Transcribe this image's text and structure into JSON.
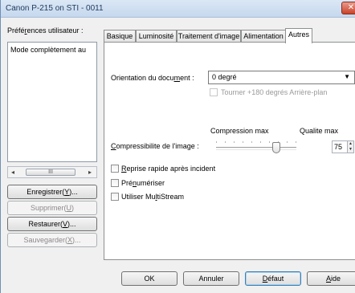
{
  "window": {
    "title": "Canon P-215 on STI - 0011",
    "close": "✕"
  },
  "left": {
    "prefs_label_pre": "Préfé",
    "prefs_label_u": "r",
    "prefs_label_post": "ences utilisateur :",
    "list_item": "Mode complètement au",
    "scroll_thumb": "III",
    "buttons": {
      "save": {
        "pre": "Enregistrer(",
        "u": "Y",
        "post": ")..."
      },
      "delete": {
        "pre": "Supprimer(",
        "u": "U",
        "post": ")"
      },
      "restore": {
        "pre": "Restaurer(",
        "u": "V",
        "post": ")..."
      },
      "backup": {
        "pre": "Sauvegarder(",
        "u": "X",
        "post": ")..."
      }
    }
  },
  "tabs": [
    "Basique",
    "Luminosité",
    "Traitement d'image",
    "Alimentation",
    "Autres"
  ],
  "panel": {
    "orientation_label": {
      "pre": "Orientation du docu",
      "u": "m",
      "post": "ent :"
    },
    "orientation_value": "0 degré",
    "rotate_label": "Tourner +180 degrés Arrière-plan",
    "compression_max": "Compression max",
    "quality_max": "Qualite max",
    "compress_label": {
      "pre": "",
      "u": "C",
      "post": "ompressibilite de l'image :"
    },
    "compress_value": "75",
    "quick_resume": {
      "pre": "",
      "u": "R",
      "post": "eprise rapide après incident"
    },
    "prescan": {
      "pre": "Pré",
      "u": "n",
      "post": "umériser"
    },
    "multistream": {
      "pre": "Utiliser Mu",
      "u": "l",
      "post": "tiStream"
    }
  },
  "footer": {
    "ok": "OK",
    "cancel": "Annuler",
    "default": {
      "pre": "",
      "u": "D",
      "post": "éfaut"
    },
    "help": {
      "pre": "",
      "u": "A",
      "post": "ide"
    }
  }
}
